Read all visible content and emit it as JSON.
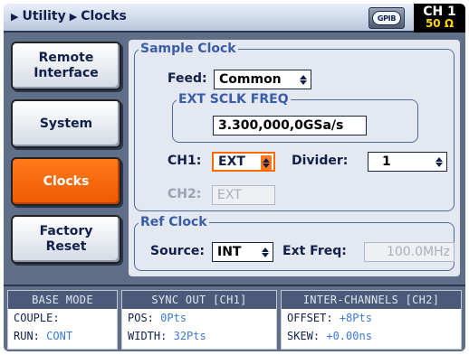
{
  "header": {
    "breadcrumb": [
      "Utility",
      "Clocks"
    ],
    "gpib_label": "GPIB",
    "channel": "CH 1",
    "impedance": "50 Ω"
  },
  "sidebar": {
    "items": [
      {
        "label": "Remote\nInterface",
        "active": false
      },
      {
        "label": "System",
        "active": false
      },
      {
        "label": "Clocks",
        "active": true
      },
      {
        "label": "Factory\nReset",
        "active": false
      }
    ]
  },
  "sample_clock": {
    "title": "Sample Clock",
    "feed_label": "Feed:",
    "feed_value": "Common",
    "ext_sclk_title": "EXT SCLK FREQ",
    "ext_sclk_value": "3.300,000,0GSa/s",
    "ch1_label": "CH1:",
    "ch1_value": "EXT",
    "divider_label": "Divider:",
    "divider_value": "1",
    "ch2_label": "CH2:",
    "ch2_value": "EXT"
  },
  "ref_clock": {
    "title": "Ref Clock",
    "source_label": "Source:",
    "source_value": "INT",
    "ext_freq_label": "Ext Freq:",
    "ext_freq_value": "100.0MHz"
  },
  "status": {
    "base_mode": {
      "title": "BASE MODE",
      "couple_label": "COUPLE:",
      "couple_value": "",
      "run_label": "RUN:",
      "run_value": "CONT"
    },
    "sync_out": {
      "title": "SYNC OUT [CH1]",
      "pos_label": "POS:",
      "pos_value": "0Pts",
      "width_label": "WIDTH:",
      "width_value": "32Pts"
    },
    "inter_channels": {
      "title": "INTER-CHANNELS [CH2]",
      "offset_label": "OFFSET:",
      "offset_value": "+8Pts",
      "skew_label": "SKEW:",
      "skew_value": "+0.00ns"
    }
  },
  "colors": {
    "accent": "#ff6a00",
    "frame": "#5f6f87",
    "title_blue": "#3a5da8",
    "value_blue": "#3d79d6",
    "impedance_yellow": "#ffd200"
  }
}
